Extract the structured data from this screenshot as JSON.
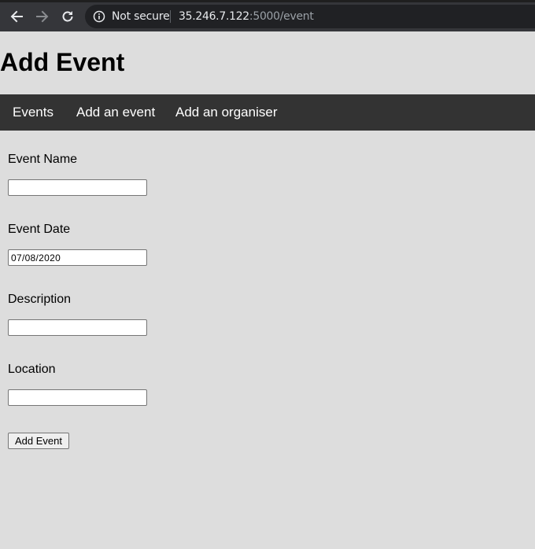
{
  "browser": {
    "security_label": "Not secure",
    "url_host": "35.246.7.122",
    "url_rest": ":5000/event"
  },
  "page": {
    "title": "Add Event"
  },
  "nav": {
    "items": [
      {
        "label": "Events"
      },
      {
        "label": "Add an event"
      },
      {
        "label": "Add an organiser"
      }
    ]
  },
  "form": {
    "fields": [
      {
        "label": "Event Name",
        "value": ""
      },
      {
        "label": "Event Date",
        "value": "07/08/2020"
      },
      {
        "label": "Description",
        "value": ""
      },
      {
        "label": "Location",
        "value": ""
      }
    ],
    "submit_label": "Add Event"
  }
}
